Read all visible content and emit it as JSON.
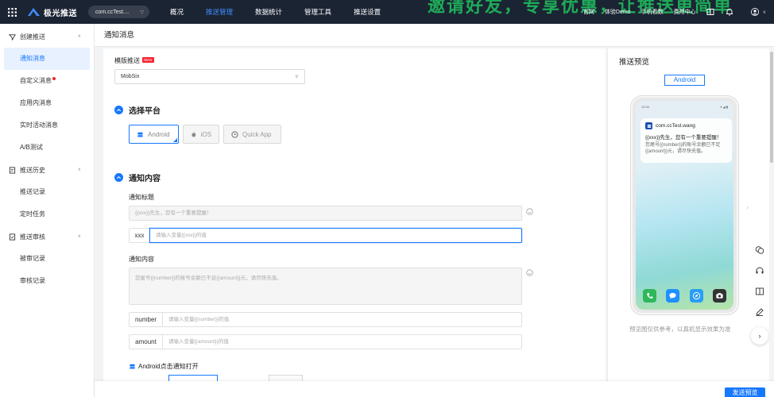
{
  "topbar": {
    "brand": "极光推送",
    "app_select": "com.ccTest....",
    "nav": [
      "概况",
      "推送管理",
      "数据统计",
      "管理工具",
      "推送设置"
    ],
    "nav_active_index": 1,
    "banner_text": "邀请好友，专享优惠，让推送更简单",
    "links": [
      "官网",
      "体验Demo",
      "手机看数",
      "费用中心"
    ]
  },
  "sidebar": {
    "groups": [
      {
        "label": "创建推送",
        "items": [
          "通知消息",
          "自定义消息",
          "应用内消息",
          "实时活动消息",
          "A/B测试"
        ]
      },
      {
        "label": "推送历史",
        "items": [
          "推送记录",
          "定时任务"
        ]
      },
      {
        "label": "推送审核",
        "items": [
          "被审记录",
          "审核记录"
        ]
      }
    ],
    "active_item": "通知消息"
  },
  "page": {
    "title": "通知消息"
  },
  "form": {
    "template_label": "模版推送",
    "new_badge": "NEW",
    "template_value": "MobSix",
    "section_platform": "选择平台",
    "platforms": [
      "Android",
      "iOS",
      "Quick App"
    ],
    "section_content": "通知内容",
    "title_label": "通知标题",
    "title_value": "{{xxx}}先生，您有一个重要提醒！",
    "xxx_prefix": "xxx",
    "xxx_placeholder": "请输入变量{{xxx}}的值",
    "content_label": "通知内容",
    "content_value": "您尾号{{number}}的账号余额已不足{{amount}}元，请尽快充值。",
    "number_prefix": "number",
    "number_placeholder": "请输入变量{{number}}的值",
    "amount_prefix": "amount",
    "amount_placeholder": "请输入变量{{amount}}的值",
    "android_click_label": "Android点击通知打开"
  },
  "preview": {
    "title": "推送预览",
    "tab": "Android",
    "time": "12:00",
    "notif_app": "com.ccTest.wang",
    "notif_title": "{{xxx}}先生，您有一个重要提醒！",
    "notif_body": "您尾号{{number}}的账号余额已不足{{amount}}元，请尽快充值。",
    "note": "预览图仅供参考，以真机显示效果为准"
  },
  "footer": {
    "send_button": "发送预览"
  },
  "colors": {
    "primary": "#1677ff",
    "topbar": "#1b2433",
    "banner": "#1fb35b"
  }
}
